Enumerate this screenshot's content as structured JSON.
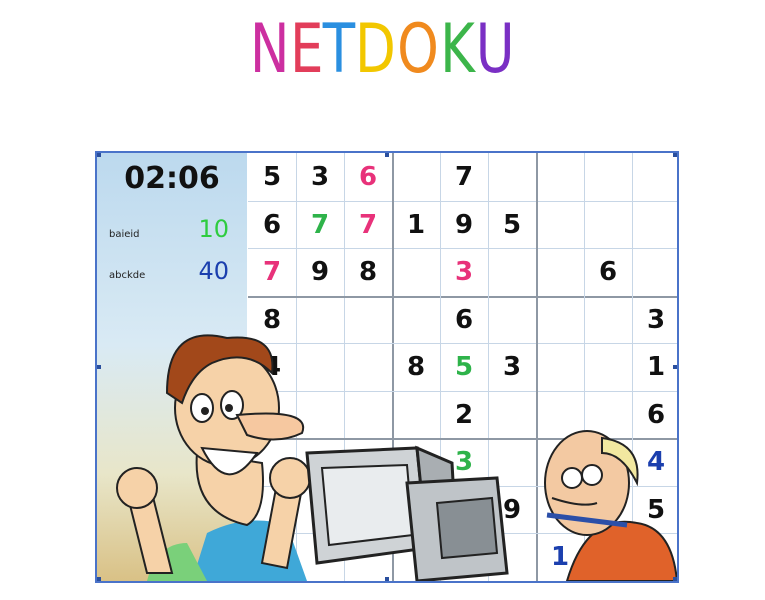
{
  "title": {
    "text": "NETDOKU",
    "letter_colors": [
      "#cc2fa0",
      "#e23d5a",
      "#2a8fe0",
      "#f2c700",
      "#f08a1e",
      "#3cb54a",
      "#7a2fc4"
    ]
  },
  "timer": "02:06",
  "players": [
    {
      "name": "baieid",
      "score": "10",
      "color": "#2ecc40"
    },
    {
      "name": "abckde",
      "score": "40",
      "color": "#1b3fae"
    }
  ],
  "grid": {
    "rows": [
      [
        {
          "v": "5",
          "c": "black"
        },
        {
          "v": "3",
          "c": "black"
        },
        {
          "v": "6",
          "c": "pink"
        },
        {
          "v": "",
          "c": ""
        },
        {
          "v": "7",
          "c": "black"
        },
        {
          "v": "",
          "c": ""
        },
        {
          "v": "",
          "c": ""
        },
        {
          "v": "",
          "c": ""
        },
        {
          "v": "",
          "c": ""
        }
      ],
      [
        {
          "v": "6",
          "c": "black"
        },
        {
          "v": "7",
          "c": "green"
        },
        {
          "v": "7",
          "c": "pink"
        },
        {
          "v": "1",
          "c": "black"
        },
        {
          "v": "9",
          "c": "black"
        },
        {
          "v": "5",
          "c": "black"
        },
        {
          "v": "",
          "c": ""
        },
        {
          "v": "",
          "c": ""
        },
        {
          "v": "",
          "c": ""
        }
      ],
      [
        {
          "v": "7",
          "c": "pink"
        },
        {
          "v": "9",
          "c": "black"
        },
        {
          "v": "8",
          "c": "black"
        },
        {
          "v": "",
          "c": ""
        },
        {
          "v": "3",
          "c": "pink"
        },
        {
          "v": "",
          "c": ""
        },
        {
          "v": "",
          "c": ""
        },
        {
          "v": "6",
          "c": "black"
        },
        {
          "v": "",
          "c": ""
        }
      ],
      [
        {
          "v": "8",
          "c": "black"
        },
        {
          "v": "",
          "c": ""
        },
        {
          "v": "",
          "c": ""
        },
        {
          "v": "",
          "c": ""
        },
        {
          "v": "6",
          "c": "black"
        },
        {
          "v": "",
          "c": ""
        },
        {
          "v": "",
          "c": ""
        },
        {
          "v": "",
          "c": ""
        },
        {
          "v": "3",
          "c": "black"
        }
      ],
      [
        {
          "v": "4",
          "c": "black"
        },
        {
          "v": "",
          "c": ""
        },
        {
          "v": "",
          "c": ""
        },
        {
          "v": "8",
          "c": "black"
        },
        {
          "v": "5",
          "c": "green"
        },
        {
          "v": "3",
          "c": "black"
        },
        {
          "v": "",
          "c": ""
        },
        {
          "v": "",
          "c": ""
        },
        {
          "v": "1",
          "c": "black"
        }
      ],
      [
        {
          "v": "",
          "c": ""
        },
        {
          "v": "",
          "c": ""
        },
        {
          "v": "",
          "c": ""
        },
        {
          "v": "",
          "c": ""
        },
        {
          "v": "2",
          "c": "black"
        },
        {
          "v": "",
          "c": ""
        },
        {
          "v": "",
          "c": ""
        },
        {
          "v": "",
          "c": ""
        },
        {
          "v": "6",
          "c": "black"
        }
      ],
      [
        {
          "v": "",
          "c": ""
        },
        {
          "v": "",
          "c": ""
        },
        {
          "v": "",
          "c": ""
        },
        {
          "v": "",
          "c": ""
        },
        {
          "v": "3",
          "c": "green"
        },
        {
          "v": "",
          "c": ""
        },
        {
          "v": "",
          "c": ""
        },
        {
          "v": "",
          "c": ""
        },
        {
          "v": "4",
          "c": "blue"
        }
      ],
      [
        {
          "v": "",
          "c": ""
        },
        {
          "v": "",
          "c": ""
        },
        {
          "v": "",
          "c": ""
        },
        {
          "v": "",
          "c": ""
        },
        {
          "v": "",
          "c": ""
        },
        {
          "v": "9",
          "c": "black"
        },
        {
          "v": "",
          "c": ""
        },
        {
          "v": "",
          "c": ""
        },
        {
          "v": "5",
          "c": "black"
        }
      ],
      [
        {
          "v": "",
          "c": ""
        },
        {
          "v": "",
          "c": ""
        },
        {
          "v": "",
          "c": ""
        },
        {
          "v": "",
          "c": ""
        },
        {
          "v": "",
          "c": ""
        },
        {
          "v": "",
          "c": ""
        },
        {
          "v": "1",
          "c": "blue"
        },
        {
          "v": "",
          "c": ""
        },
        {
          "v": "",
          " c": ""
        }
      ]
    ],
    "colors": {
      "black": "#111111",
      "pink": "#e8327a",
      "green": "#2eb34a",
      "blue": "#1b3fae"
    }
  }
}
